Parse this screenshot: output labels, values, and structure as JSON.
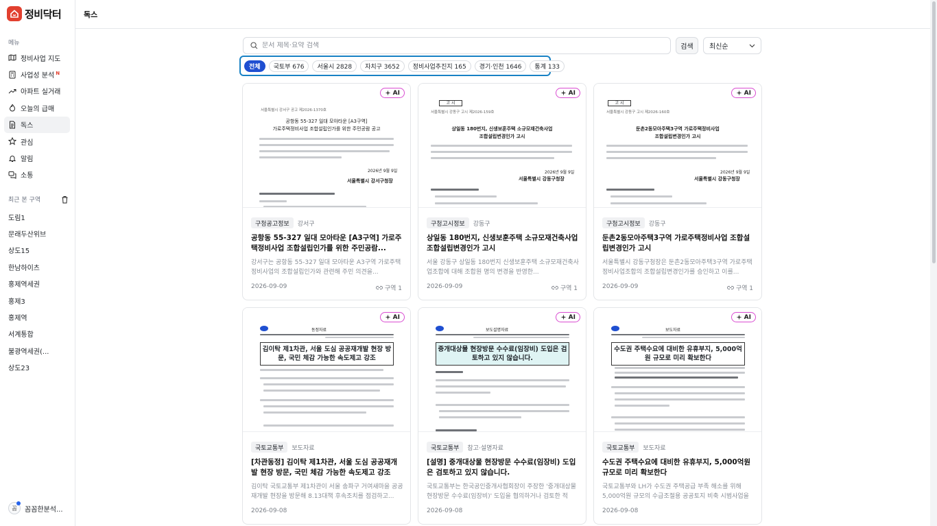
{
  "app": {
    "name": "정비닥터",
    "brand_color": "#e2402f"
  },
  "header": {
    "title": "독스"
  },
  "sidebar": {
    "menu_label": "메뉴",
    "items": [
      {
        "label": "정비사업 지도",
        "icon": "map-icon"
      },
      {
        "label": "사업성 분석",
        "icon": "calculator-icon",
        "badge": "N"
      },
      {
        "label": "아파트 실거래",
        "icon": "trend-icon"
      },
      {
        "label": "오늘의 급매",
        "icon": "flame-icon"
      },
      {
        "label": "독스",
        "icon": "document-icon",
        "active": true
      },
      {
        "label": "관심",
        "icon": "star-icon"
      },
      {
        "label": "알림",
        "icon": "bell-icon"
      },
      {
        "label": "소통",
        "icon": "chat-icon"
      }
    ],
    "recent_label": "최근 본 구역",
    "recent": [
      "도림1",
      "문래두산위브",
      "상도15",
      "한남하이츠",
      "홍제역세권",
      "홍제3",
      "홍제역",
      "서계통합",
      "불광역세권(...",
      "상도23"
    ],
    "user": {
      "avatar": "꼼",
      "name": "꼼꼼한분석..."
    }
  },
  "search": {
    "placeholder": "문서 제목·요약 검색",
    "value": "",
    "button": "검색",
    "sort": "최신순"
  },
  "filters": [
    {
      "label": "전체",
      "active": true
    },
    {
      "label": "국토부 676"
    },
    {
      "label": "서울시 2828"
    },
    {
      "label": "자치구 3652"
    },
    {
      "label": "정비사업추진지 165"
    },
    {
      "label": "경기·인천 1646"
    },
    {
      "label": "통계 133"
    }
  ],
  "cards": [
    {
      "ai": "AI",
      "doc_header": "서울특별시 강서구 공고 제2026-1370호",
      "doc_title1": "공항동 55-327 일대 모아타운 [A3구역]",
      "doc_title2": "가로주택정비사업 조합설립인가를 위한 주민공람 공고",
      "doc_sign": "서울특별시 강서구청장",
      "doc_date": "2026년 9월 9일",
      "tag": "구청공고정보",
      "sub": "강서구",
      "title": "공항동 55-327 일대 모아타운 [A3구역] 가로주택정비사업 조합설립인가를 위한 주민공람...",
      "summary": "강서구는 공항동 55-327 일대 모아타운 A3구역 가로주택정비사업의 조합설립인가와 관련해 주민 의견을...",
      "date": "2026-09-09",
      "area": "구역 1"
    },
    {
      "ai": "AI",
      "doc_box": "고 시",
      "doc_header": "서울특별시 강동구 고시 제2026-159호",
      "doc_title1": "상일동 180번지, 신생보훈주택 소규모재건축사업",
      "doc_title2": "조합설립변경인가 고시",
      "doc_sign": "서울특별시 강동구청장",
      "doc_date": "2026년 9월 9일",
      "tag": "구청고시정보",
      "sub": "강동구",
      "title": "상일동 180번지, 신생보훈주택 소규모재건축사업 조합설립변경인가 고시",
      "summary": "서울 강동구 상일동 180번지 신생보훈주택 소규모재건축사업조합에 대해 조합원 명의 변경을 반영한...",
      "date": "2026-09-09",
      "area": "구역 1"
    },
    {
      "ai": "AI",
      "doc_box": "고 시",
      "doc_header": "서울특별시 강동구 고시 제2026-160호",
      "doc_title1": "둔촌2동모아주택3구역 가로주택정비사업",
      "doc_title2": "조합설립변경인가 고시",
      "doc_sign": "서울특별시 강동구청장",
      "doc_date": "2026년 9월 9일",
      "tag": "구청고시정보",
      "sub": "강동구",
      "title": "둔촌2동모아주택3구역 가로주택정비사업 조합설립변경인가 고시",
      "summary": "서울특별시 강동구청장은 둔촌2동모아주택3구역 가로주택정비사업조합의 조합설립변경인가를 승인하고 이를...",
      "date": "2026-09-09",
      "area": "구역 1"
    },
    {
      "ai": "AI",
      "doc_kind": "동정자료",
      "doc_boxtitle": "김이탁 제1차관, 서울 도심 공공재개발 현장 방문, 국민 체감 가능한 속도제고 강조",
      "tag": "국토교통부",
      "sub": "보도자료",
      "title": "[차관동정] 김이탁 제1차관, 서울 도심 공공재개발 현장 방문, 국민 체감 가능한 속도제고 강조",
      "summary": "김이탁 국토교통부 제1차관이 서울 송파구 거여새마을 공공재개발 현장을 방문해 8.13대책 후속조치를 점검하고...",
      "date": "2026-09-08",
      "area": ""
    },
    {
      "ai": "AI",
      "doc_kind": "보도설명자료",
      "doc_boxtitle": "중개대상물 현장방문 수수료(임장비) 도입은 검토하고 있지 않습니다.",
      "tag": "국토교통부",
      "sub": "참고·설명자료",
      "title": "[설명] 중개대상물 현장방문 수수료(임장비) 도입은 검토하고 있지 않습니다.",
      "summary": "국토교통부는 한국공인중개사협회장이 주장한 '중개대상물 현장방문 수수료(임장비)' 도입을 협의하거나 검토한 적이...",
      "date": "2026-09-08",
      "area": ""
    },
    {
      "ai": "AI",
      "doc_kind": "보도자료",
      "doc_boxtitle": "수도권 주택수요에 대비한 유휴부지, 5,000억원 규모로 미리 확보한다",
      "tag": "국토교통부",
      "sub": "보도자료",
      "title": "수도권 주택수요에 대비한 유휴부지, 5,000억원 규모로 미리 확보한다",
      "summary": "국토교통부와 LH가 수도권 주택공급 부족 해소를 위해 5,000억원 규모의 수급조절용 공공토지 비축 시범사업을 9...",
      "date": "2026-09-08",
      "area": ""
    }
  ]
}
